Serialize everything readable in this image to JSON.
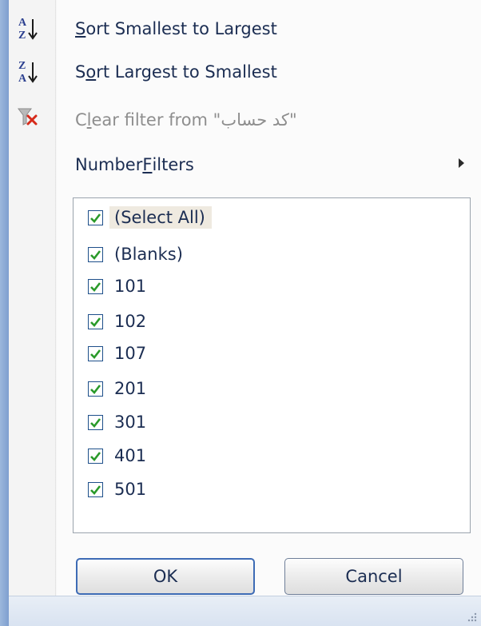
{
  "menu": {
    "sort_asc": {
      "hotkey": "S",
      "rest": "ort Smallest to Largest"
    },
    "sort_desc": {
      "before": "S",
      "hotkey": "o",
      "rest": "rt Largest to Smallest"
    },
    "clear_filter": {
      "before": "C",
      "hotkey": "l",
      "rest": "ear filter from \"کد حساب\""
    },
    "number_filters": {
      "before": "Number ",
      "hotkey": "F",
      "rest": "ilters"
    }
  },
  "filter_list": {
    "items": [
      {
        "label": "(Select All)",
        "checked": true
      },
      {
        "label": "(Blanks)",
        "checked": true
      },
      {
        "label": "101",
        "checked": true
      },
      {
        "label": "102",
        "checked": true
      },
      {
        "label": "107",
        "checked": true
      },
      {
        "label": "201",
        "checked": true
      },
      {
        "label": "301",
        "checked": true
      },
      {
        "label": "401",
        "checked": true
      },
      {
        "label": "501",
        "checked": true
      }
    ]
  },
  "buttons": {
    "ok": "OK",
    "cancel": "Cancel"
  },
  "colors": {
    "accent_frame": "#7e9fcf",
    "checkbox_border": "#1e4f8a",
    "check_mark": "#2a9a2a",
    "clear_filter_x": "#d62a1a",
    "selection_highlight": "#efeae0"
  }
}
